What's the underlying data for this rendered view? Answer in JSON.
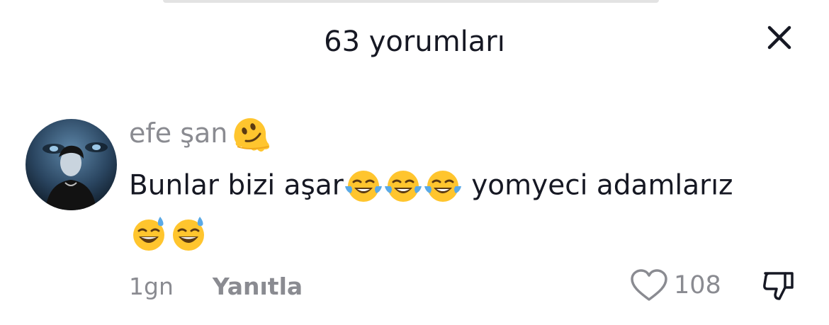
{
  "header": {
    "title": "63 yorumları",
    "close_icon": "close-icon"
  },
  "comment": {
    "username": "efe şan",
    "username_emoji": "melting-face-emoji",
    "text_before": "Bunlar bizi aşar",
    "emojis_inline": [
      "face-with-tears-of-joy-emoji",
      "face-with-tears-of-joy-emoji",
      "face-with-tears-of-joy-emoji"
    ],
    "text_after": " yomyeci adamlarız",
    "emojis_end": [
      "grinning-face-with-sweat-emoji",
      "grinning-face-with-sweat-emoji"
    ],
    "time_ago": "1gn",
    "reply_label": "Yanıtla",
    "like_count": "108",
    "like_icon": "heart-outline-icon",
    "dislike_icon": "thumbs-down-icon"
  },
  "colors": {
    "text_primary": "#161823",
    "text_secondary": "#8a8b91",
    "emoji_yellow": "#ffc52e",
    "tear_blue": "#5aa9e6"
  }
}
